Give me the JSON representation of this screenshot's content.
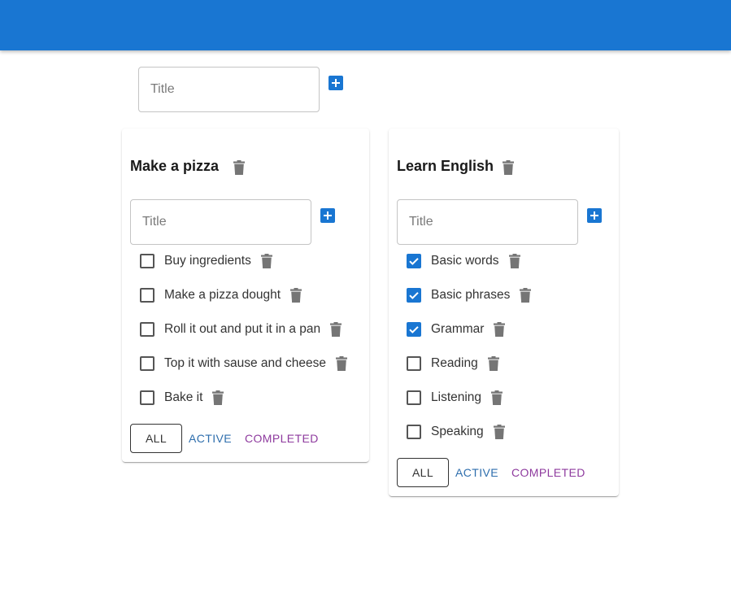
{
  "new_list": {
    "placeholder": "Title"
  },
  "lists": [
    {
      "title": "Make a pizza",
      "input_placeholder": "Title",
      "tasks": [
        {
          "label": "Buy ingredients",
          "done": false
        },
        {
          "label": "Make a pizza dought",
          "done": false
        },
        {
          "label": "Roll it out and put it in a pan",
          "done": false
        },
        {
          "label": "Top it with sause and cheese",
          "done": false
        },
        {
          "label": "Bake it",
          "done": false
        }
      ],
      "filters": {
        "all": "ALL",
        "active": "ACTIVE",
        "completed": "COMPLETED"
      }
    },
    {
      "title": "Learn English",
      "input_placeholder": "Title",
      "tasks": [
        {
          "label": "Basic words",
          "done": true
        },
        {
          "label": "Basic phrases",
          "done": true
        },
        {
          "label": "Grammar",
          "done": true
        },
        {
          "label": "Reading",
          "done": false
        },
        {
          "label": "Listening",
          "done": false
        },
        {
          "label": "Speaking",
          "done": false
        }
      ],
      "filters": {
        "all": "ALL",
        "active": "ACTIVE",
        "completed": "COMPLETED"
      }
    }
  ],
  "colors": {
    "primary": "#1976d2",
    "active_link": "#2e6ead",
    "completed_link": "#8e3a9e",
    "icon_gray": "#757575"
  },
  "icons": {
    "add": "plus-box-icon",
    "delete": "trash-icon",
    "checked": "checkbox-checked-icon",
    "unchecked": "checkbox-unchecked-icon"
  }
}
